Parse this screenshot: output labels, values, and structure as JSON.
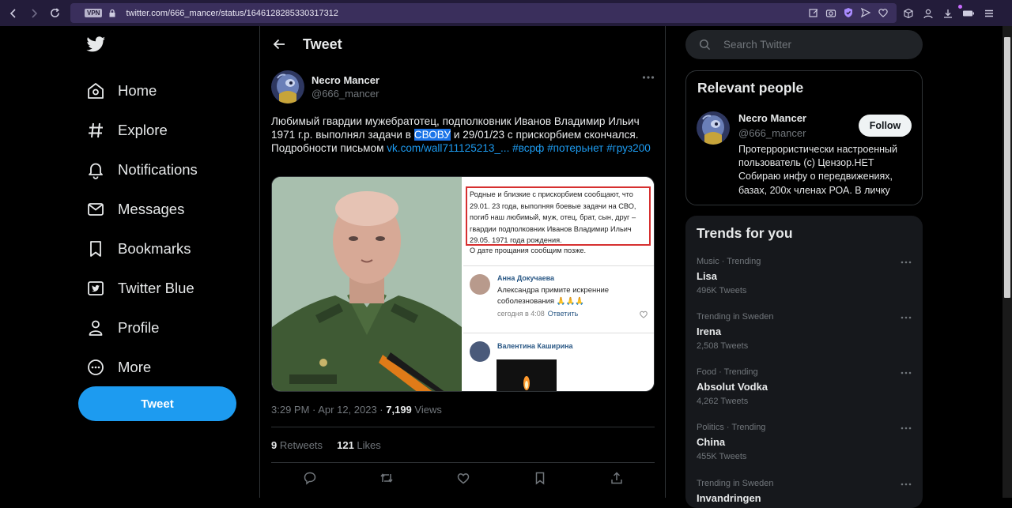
{
  "browser": {
    "vpn_label": "VPN",
    "url": "twitter.com/666_mancer/status/1646128285330317312",
    "accent": "#231c3a"
  },
  "nav": {
    "items": [
      {
        "label": "Home",
        "icon": "home-icon"
      },
      {
        "label": "Explore",
        "icon": "hashtag-icon"
      },
      {
        "label": "Notifications",
        "icon": "bell-icon"
      },
      {
        "label": "Messages",
        "icon": "envelope-icon"
      },
      {
        "label": "Bookmarks",
        "icon": "bookmark-icon"
      },
      {
        "label": "Twitter Blue",
        "icon": "twitter-blue-icon"
      },
      {
        "label": "Profile",
        "icon": "person-icon"
      },
      {
        "label": "More",
        "icon": "more-circle-icon"
      }
    ],
    "tweet_button": "Tweet"
  },
  "header": {
    "title": "Tweet"
  },
  "tweet": {
    "author_name": "Necro Mancer",
    "author_handle": "@666_mancer",
    "text_1": "Любимый гвардии мужебратотец, подполковник  Иванов Владимир Ильич 1971 г.р. выполнял задачи в ",
    "text_highlight": "СВОВУ",
    "text_2": " и 29/01/23 с прискорбием скончался. Подробности письмом ",
    "link": "vk.com/wall711125213_...",
    "hashtag_1": "#всрф",
    "hashtag_2": "#потерьнет",
    "hashtag_3": "#груз200",
    "time": "3:29 PM · Apr 12, 2023 · ",
    "views_count": "7,199",
    "views_label": " Views",
    "retweets_count": "9",
    "retweets_label": " Retweets",
    "likes_count": "121",
    "likes_label": " Likes"
  },
  "media_screenshot": {
    "box_text": "Родные и близкие с прискорбием сообщают, что 29.01. 23 года, выполняя боевые задачи на СВО, погиб наш любимый, муж, отец, брат, сын, друг – гвардии подполковник Иванов Владимир Ильич 29.05. 1971 года рождения.",
    "after_text": "О дате прощания сообщим позже.",
    "comment_1_name": "Анна Докучаева",
    "comment_1_text": "Александра примите искренние соболезнования 🙏🙏🙏",
    "comment_1_time": "сегодня в 4:08",
    "comment_1_reply": "Ответить",
    "comment_2_name": "Валентина Каширина"
  },
  "search": {
    "placeholder": "Search Twitter"
  },
  "relevant": {
    "title": "Relevant people",
    "name": "Necro Mancer",
    "handle": "@666_mancer",
    "follow_label": "Follow",
    "bio": "Протеррористически настроенный пользователь (с) Цензор.НЕТ Собираю инфу о передвижениях, базах, 200х членах РОА. В личку"
  },
  "trends": {
    "title": "Trends for you",
    "items": [
      {
        "context": "Music · Trending",
        "name": "Lisa",
        "count": "496K Tweets"
      },
      {
        "context": "Trending in Sweden",
        "name": "Irena",
        "count": "2,508 Tweets"
      },
      {
        "context": "Food · Trending",
        "name": "Absolut Vodka",
        "count": "4,262 Tweets"
      },
      {
        "context": "Politics · Trending",
        "name": "China",
        "count": "455K Tweets"
      },
      {
        "context": "Trending in Sweden",
        "name": "Invandringen",
        "count": ""
      }
    ]
  }
}
